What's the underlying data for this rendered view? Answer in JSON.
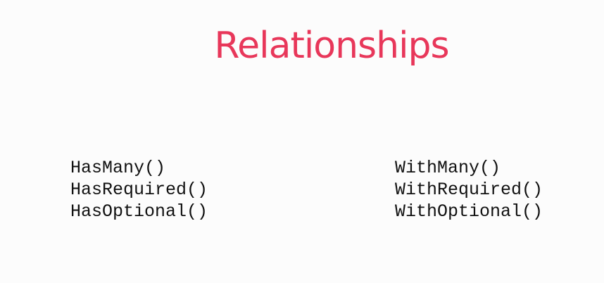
{
  "slide": {
    "title": "Relationships",
    "left_methods": [
      "HasMany()",
      "HasRequired()",
      "HasOptional()"
    ],
    "right_methods": [
      "WithMany()",
      "WithRequired()",
      "WithOptional()"
    ],
    "colors": {
      "title": "#e8375a",
      "text": "#111111",
      "background": "#fcfcfc"
    }
  }
}
